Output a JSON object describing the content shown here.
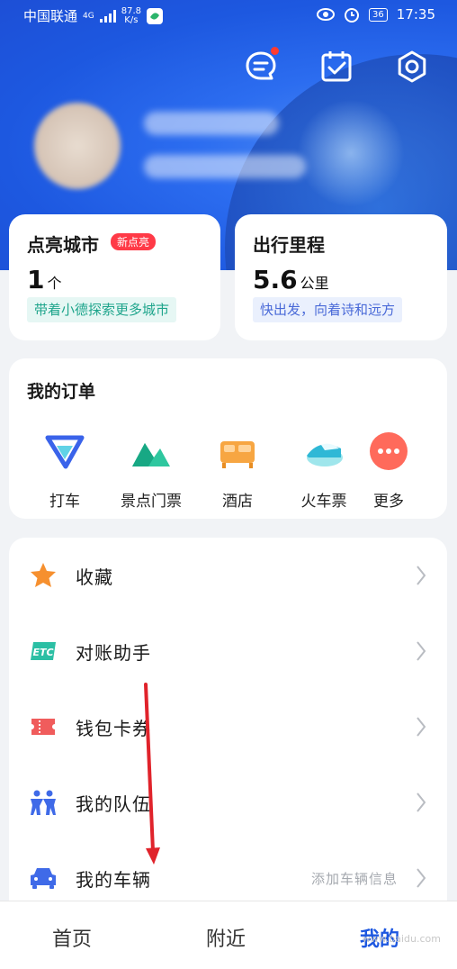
{
  "status": {
    "carrier": "中国联通",
    "net": "4G",
    "speed_top": "87.8",
    "speed_bottom": "K/s",
    "battery": "36",
    "time": "17:35"
  },
  "stats": {
    "cities": {
      "title": "点亮城市",
      "badge": "新点亮",
      "value": "1",
      "unit": "个",
      "tip": "带着小德探索更多城市"
    },
    "mileage": {
      "title": "出行里程",
      "value": "5.6",
      "unit": "公里",
      "tip": "快出发，向着诗和远方"
    }
  },
  "orders": {
    "title": "我的订单",
    "items": [
      {
        "label": "打车",
        "icon": "taxi-icon"
      },
      {
        "label": "景点门票",
        "icon": "mountain-icon"
      },
      {
        "label": "酒店",
        "icon": "bed-icon"
      },
      {
        "label": "火车票",
        "icon": "train-icon"
      },
      {
        "label": "更多",
        "icon": "more-icon"
      }
    ]
  },
  "menu": [
    {
      "label": "收藏",
      "hint": "",
      "icon": "star-icon"
    },
    {
      "label": "对账助手",
      "hint": "",
      "icon": "etc-icon"
    },
    {
      "label": "钱包卡券",
      "hint": "",
      "icon": "coupon-icon"
    },
    {
      "label": "我的队伍",
      "hint": "",
      "icon": "team-icon"
    },
    {
      "label": "我的车辆",
      "hint": "添加车辆信息",
      "icon": "car-icon"
    }
  ],
  "tabs": [
    {
      "label": "首页"
    },
    {
      "label": "附近"
    },
    {
      "label": "我的"
    }
  ],
  "colors": {
    "brand": "#1d57e0",
    "badge": "#ff3a47",
    "annotation_arrow": "#e0232b"
  },
  "watermark": "www.baidu.com"
}
